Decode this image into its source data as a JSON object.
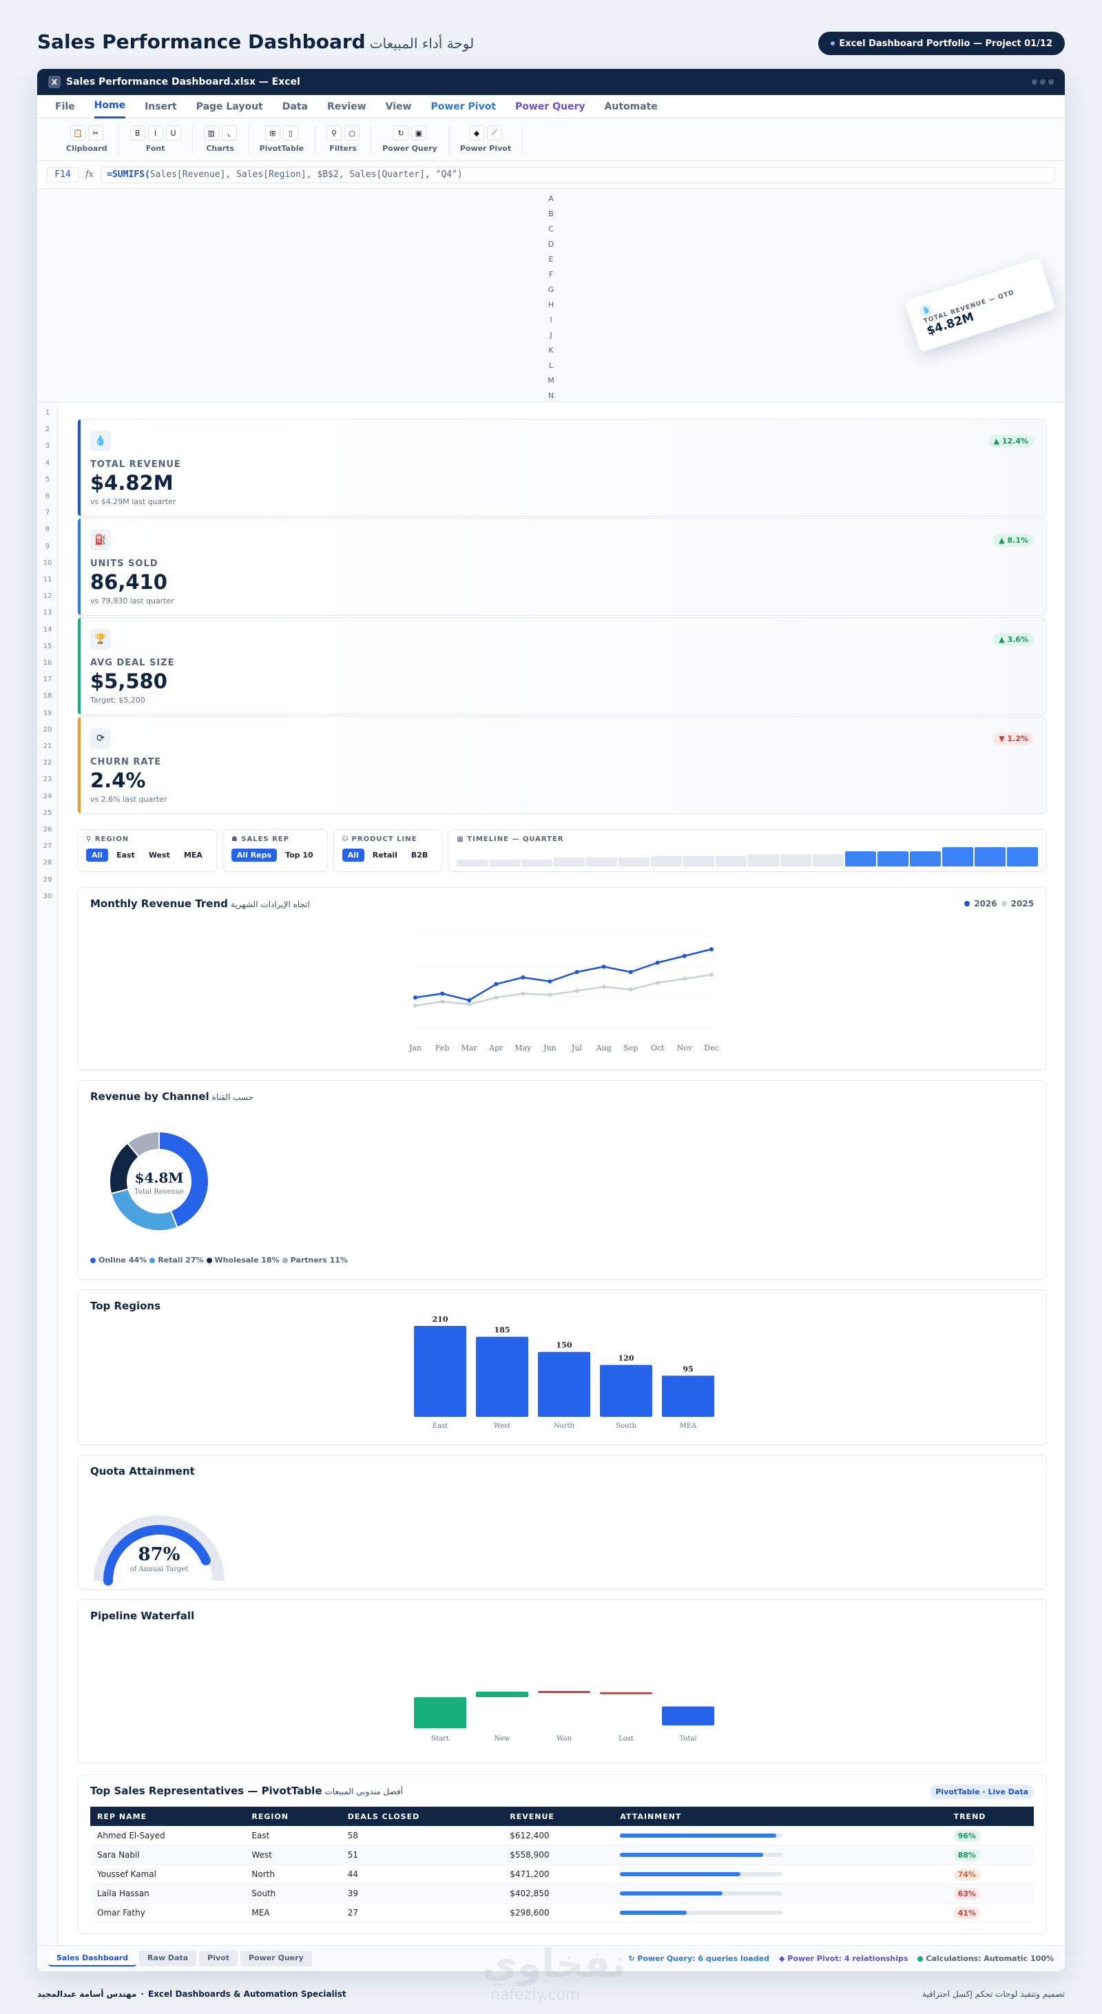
{
  "page": {
    "title": "Sales Performance Dashboard",
    "title_ar": "لوحة أداء المبيعات",
    "portfolio_pill": "Excel Dashboard Portfolio — Project 01/12"
  },
  "window": {
    "app_icon": "X",
    "title": "Sales Performance Dashboard.xlsx — Excel"
  },
  "menu": [
    "File",
    "Home",
    "Insert",
    "Page Layout",
    "Data",
    "Review",
    "View",
    "Power Pivot",
    "Power Query",
    "Automate"
  ],
  "ribbon": [
    {
      "label": "Clipboard",
      "icons": [
        "📋",
        "✂"
      ]
    },
    {
      "label": "Font",
      "icons": [
        "B",
        "I",
        "U"
      ]
    },
    {
      "label": "Charts",
      "icons": [
        "▥",
        "⌞"
      ]
    },
    {
      "label": "PivotTable",
      "icons": [
        "⊞",
        "▯"
      ]
    },
    {
      "label": "Filters",
      "icons": [
        "⚲",
        "○"
      ]
    },
    {
      "label": "Power Query",
      "icons": [
        "↻",
        "▣"
      ]
    },
    {
      "label": "Power Pivot",
      "icons": [
        "◆",
        "⟋"
      ]
    }
  ],
  "formula": {
    "cell": "F14",
    "fx": "fx",
    "fn": "=SUMIFS(",
    "args": " Sales[Revenue], Sales[Region], $B$2, Sales[Quarter], \"Q4\")"
  },
  "columns": [
    "A",
    "B",
    "C",
    "D",
    "E",
    "F",
    "G",
    "H",
    "I",
    "J",
    "K",
    "L",
    "M",
    "N"
  ],
  "floating_card": {
    "label": "TOTAL REVENUE — QTD",
    "value": "$4.82M"
  },
  "rows": [
    "1",
    "2",
    "3",
    "4",
    "5",
    "6",
    "7",
    "8",
    "9",
    "10",
    "11",
    "12",
    "13",
    "14",
    "15",
    "16",
    "17",
    "18",
    "19",
    "20",
    "21",
    "22",
    "23",
    "24",
    "25",
    "26",
    "27",
    "28",
    "29",
    "30"
  ],
  "kpis": [
    {
      "label": "TOTAL REVENUE",
      "value": "$4.82M",
      "sub": "vs $4.29M last quarter",
      "badge": "▲ 12.4%",
      "trend": "up",
      "accent": "#1d54d6",
      "icon": "💧"
    },
    {
      "label": "UNITS SOLD",
      "value": "86,410",
      "sub": "vs 79,930 last quarter",
      "badge": "▲ 8.1%",
      "trend": "up",
      "accent": "#2f7de8",
      "icon": "⛽"
    },
    {
      "label": "AVG DEAL SIZE",
      "value": "$5,580",
      "sub": "Target: $5,200",
      "badge": "▲ 3.6%",
      "trend": "up",
      "accent": "#17b07a",
      "icon": "🏆"
    },
    {
      "label": "CHURN RATE",
      "value": "2.4%",
      "sub": "vs 2.6% last quarter",
      "badge": "▼ 1.2%",
      "trend": "down",
      "accent": "#f0a020",
      "icon": "⟳"
    }
  ],
  "filters": {
    "region": {
      "title": "⚲ REGION",
      "chips": [
        "All",
        "East",
        "West",
        "MEA"
      ]
    },
    "rep": {
      "title": "☗ SALES REP",
      "chips": [
        "All Reps",
        "Top 10"
      ]
    },
    "product": {
      "title": "⛁ PRODUCT LINE",
      "chips": [
        "All",
        "Retail",
        "B2B"
      ]
    },
    "timeline": {
      "title": "▦ TIMELINE — QUARTER"
    }
  },
  "timeline_levels": [
    0.35,
    0.35,
    0.35,
    0.45,
    0.45,
    0.45,
    0.55,
    0.55,
    0.55,
    0.65,
    0.65,
    0.65,
    0.8,
    0.8,
    0.8,
    1,
    1,
    1
  ],
  "timeline_selected_from": 12,
  "trend_card": {
    "title": "Monthly Revenue Trend",
    "title_ar": "اتجاه الإيرادات الشهرية",
    "legend": [
      "2026",
      "2025"
    ]
  },
  "donut_card": {
    "title": "Revenue by Channel",
    "title_ar": "حسب القناة",
    "center_value": "$4.8M",
    "center_label": "Total Revenue"
  },
  "regions_card": {
    "title": "Top Regions"
  },
  "quota_card": {
    "title": "Quota Attainment",
    "value": "87%",
    "label": "of Annual Target"
  },
  "waterfall_card": {
    "title": "Pipeline Waterfall"
  },
  "chart_data": [
    {
      "type": "line",
      "title": "Monthly Revenue Trend",
      "categories": [
        "Jan",
        "Feb",
        "Mar",
        "Apr",
        "May",
        "Jun",
        "Jul",
        "Aug",
        "Sep",
        "Oct",
        "Nov",
        "Dec"
      ],
      "ylim": [
        0,
        100
      ],
      "series": [
        {
          "name": "2026",
          "values": [
            26,
            29,
            24,
            36,
            41,
            38,
            45,
            49,
            45,
            52,
            57,
            62
          ],
          "color": "#1d54d6"
        },
        {
          "name": "2025",
          "values": [
            20,
            23,
            21,
            26,
            29,
            28,
            31,
            34,
            32,
            37,
            40,
            43
          ],
          "color": "#c9cfd9"
        }
      ]
    },
    {
      "type": "pie",
      "title": "Revenue by Channel",
      "categories": [
        "Online",
        "Retail",
        "Wholesale",
        "Partners"
      ],
      "values": [
        44,
        27,
        18,
        11
      ],
      "colors": [
        "#2563eb",
        "#4aa3df",
        "#102544",
        "#a7adbb"
      ]
    },
    {
      "type": "bar",
      "title": "Top Regions",
      "categories": [
        "East",
        "West",
        "North",
        "South",
        "MEA"
      ],
      "values": [
        210,
        185,
        150,
        120,
        95
      ],
      "value_labels": [
        "210",
        "185",
        "150",
        "120",
        "95"
      ],
      "ylim": [
        0,
        210
      ],
      "color": "#2563eb"
    },
    {
      "type": "gauge",
      "title": "Quota Attainment",
      "values": [
        87
      ],
      "ylim": [
        0,
        100
      ]
    },
    {
      "type": "bar",
      "title": "Pipeline Waterfall",
      "categories": [
        "Start",
        "New",
        "Won",
        "Lost",
        "Total"
      ],
      "values": [
        100,
        20,
        -4,
        -6,
        110
      ],
      "colors": [
        "#17b07a",
        "#17b07a",
        "#d23a3a",
        "#d23a3a",
        "#2563eb"
      ]
    }
  ],
  "table": {
    "title": "Top Sales Representatives — PivotTable",
    "title_ar": "أفضل مندوبي المبيعات",
    "pill": "PivotTable · Live Data",
    "headers": [
      "REP NAME",
      "REGION",
      "DEALS CLOSED",
      "REVENUE",
      "ATTAINMENT",
      "TREND"
    ],
    "rows": [
      {
        "name": "Ahmed El-Sayed",
        "region": "East",
        "deals": "58",
        "revenue": "$612,400",
        "attainment": 0.96,
        "trend": "96%",
        "tone": "g"
      },
      {
        "name": "Sara Nabil",
        "region": "West",
        "deals": "51",
        "revenue": "$558,900",
        "attainment": 0.88,
        "trend": "88%",
        "tone": "g"
      },
      {
        "name": "Youssef Kamal",
        "region": "North",
        "deals": "44",
        "revenue": "$471,200",
        "attainment": 0.74,
        "trend": "74%",
        "tone": "o"
      },
      {
        "name": "Laila Hassan",
        "region": "South",
        "deals": "39",
        "revenue": "$402,850",
        "attainment": 0.63,
        "trend": "63%",
        "tone": "r"
      },
      {
        "name": "Omar Fathy",
        "region": "MEA",
        "deals": "27",
        "revenue": "$298,600",
        "attainment": 0.41,
        "trend": "41%",
        "tone": "r"
      }
    ]
  },
  "sheet_tabs": [
    "Sales Dashboard",
    "Raw Data",
    "Pivot",
    "Power Query"
  ],
  "status": {
    "pq": "↻ Power Query: 6 queries loaded",
    "pp": "◆ Power Pivot: 4 relationships",
    "calc": "Calculations: Automatic",
    "zoom": "100%"
  },
  "footer": {
    "left_ar": "مهندس أسامة عبدالمجيد",
    "left_sep": "·",
    "left_en": "Excel Dashboards & Automation Specialist",
    "right_ar": "تصميم وتنفيذ لوحات تحكم إكسل احترافية"
  },
  "watermark": {
    "main": "نفخاوي",
    "sub": "nafezly.com"
  }
}
